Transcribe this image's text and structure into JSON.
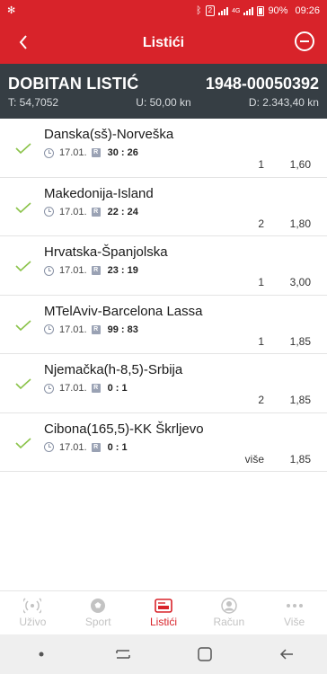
{
  "status_bar": {
    "battery": "90%",
    "time": "09:26",
    "sim_badge": "2",
    "network": "4G"
  },
  "header": {
    "title": "Listići"
  },
  "summary": {
    "status": "DOBITAN LISTIĆ",
    "ticket_code": "1948-00050392",
    "total_odds": "T: 54,7052",
    "stake": "U: 50,00 kn",
    "payout": "D: 2.343,40 kn"
  },
  "bets": [
    {
      "match": "Danska(sš)-Norveška",
      "date": "17.01.",
      "result": "30 : 26",
      "tip": "1",
      "odd": "1,60"
    },
    {
      "match": "Makedonija-Island",
      "date": "17.01.",
      "result": "22 : 24",
      "tip": "2",
      "odd": "1,80"
    },
    {
      "match": "Hrvatska-Španjolska",
      "date": "17.01.",
      "result": "23 : 19",
      "tip": "1",
      "odd": "3,00"
    },
    {
      "match": "MTelAviv-Barcelona Lassa",
      "date": "17.01.",
      "result": "99 : 83",
      "tip": "1",
      "odd": "1,85"
    },
    {
      "match": "Njemačka(h-8,5)-Srbija",
      "date": "17.01.",
      "result": "0 : 1",
      "tip": "2",
      "odd": "1,85"
    },
    {
      "match": "Cibona(165,5)-KK Škrljevo",
      "date": "17.01.",
      "result": "0 : 1",
      "tip": "više",
      "odd": "1,85"
    }
  ],
  "result_badge": "R",
  "bottom_nav": [
    {
      "label": "Uživo",
      "icon": "live-icon"
    },
    {
      "label": "Sport",
      "icon": "ball-icon"
    },
    {
      "label": "Listići",
      "icon": "ticket-icon",
      "active": true
    },
    {
      "label": "Račun",
      "icon": "account-icon"
    },
    {
      "label": "Više",
      "icon": "more-icon"
    }
  ],
  "colors": {
    "brand_red": "#d8232a",
    "summary_bg": "#363e44",
    "check_green": "#8bc34a",
    "inactive_nav": "#c3c3c3"
  }
}
